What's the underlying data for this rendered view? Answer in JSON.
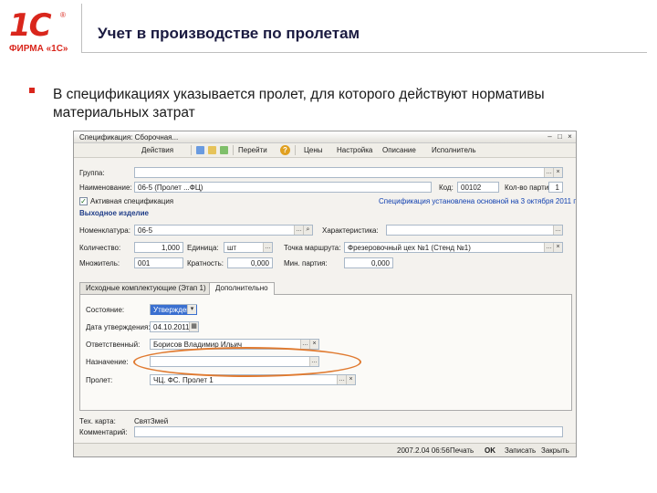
{
  "logo": {
    "mark": "1С",
    "reg": "®",
    "text": "ФИРМА «1С»"
  },
  "slide": {
    "title": "Учет в производстве по пролетам",
    "bullet_text": "В спецификациях указывается пролет, для которого действуют нормативы материальных затрат"
  },
  "window": {
    "title": "Спецификация: Сборочная...",
    "toolbar": {
      "actions_menu": "Действия",
      "go_menu": "Перейти",
      "price": "Цены",
      "settings": "Настройка",
      "description": "Описание",
      "stages": "Исполнитель"
    },
    "form": {
      "group_label": "Группа:",
      "group_value": "",
      "name_label": "Наименование:",
      "name_value": "06-5 (Пролет ...ФЦ)",
      "code_label": "Код:",
      "code_value": "00102",
      "qty_label": "Кол-во партий:",
      "qty_value": "1",
      "active_label": "Активная спецификация",
      "active_link": "Спецификация установлена основной на 3 октября 2011 г.",
      "section_output": "Выходное изделие",
      "product_label": "Номенклатура:",
      "product_value": "06-5",
      "characteristic_label": "Характеристика:",
      "characteristic_value": "",
      "quantity_label": "Количество:",
      "quantity_value": "1,000",
      "unit_label": "Единица:",
      "unit_value": "шт",
      "route_label": "Точка маршрута:",
      "route_value": "Фрезеровочный цех №1 (Стенд №1)",
      "multiplicity_label": "Множитель:",
      "multiplicity_value": "001",
      "ratio_label": "Кратность:",
      "ratio_value": "0,000",
      "output_qty_label": "Мин. партия:",
      "output_qty_value": "0,000"
    },
    "tabs": {
      "tab1": "Исходные комплектующие (Этап 1)",
      "tab2": "Дополнительно"
    },
    "tab_extra": {
      "state_label": "Состояние:",
      "state_value": "Утверждена",
      "date_label": "Дата утверждения:",
      "date_value": "04.10.2011",
      "responsible_label": "Ответственный:",
      "responsible_value": "Борисов Владимир Ильич",
      "purpose_label": "Назначение:",
      "purpose_value": "",
      "span_label": "Пролет:",
      "span_value": "ЧЦ. ФС. Пролет 1"
    },
    "bottom": {
      "techcard_label": "Тех. карта:",
      "techcard_value": "СвятЗмей",
      "comment_label": "Комментарий:",
      "comment_value": ""
    },
    "statusbar": {
      "info": "2007.2.04 06:56",
      "print": "Печать",
      "ok": "OK",
      "save": "Записать",
      "close": "Закрыть"
    }
  },
  "colors": {
    "brand_red": "#d9261c",
    "highlight": "#e07a30",
    "field_border": "#a9b8c8",
    "link": "#1040b0"
  }
}
